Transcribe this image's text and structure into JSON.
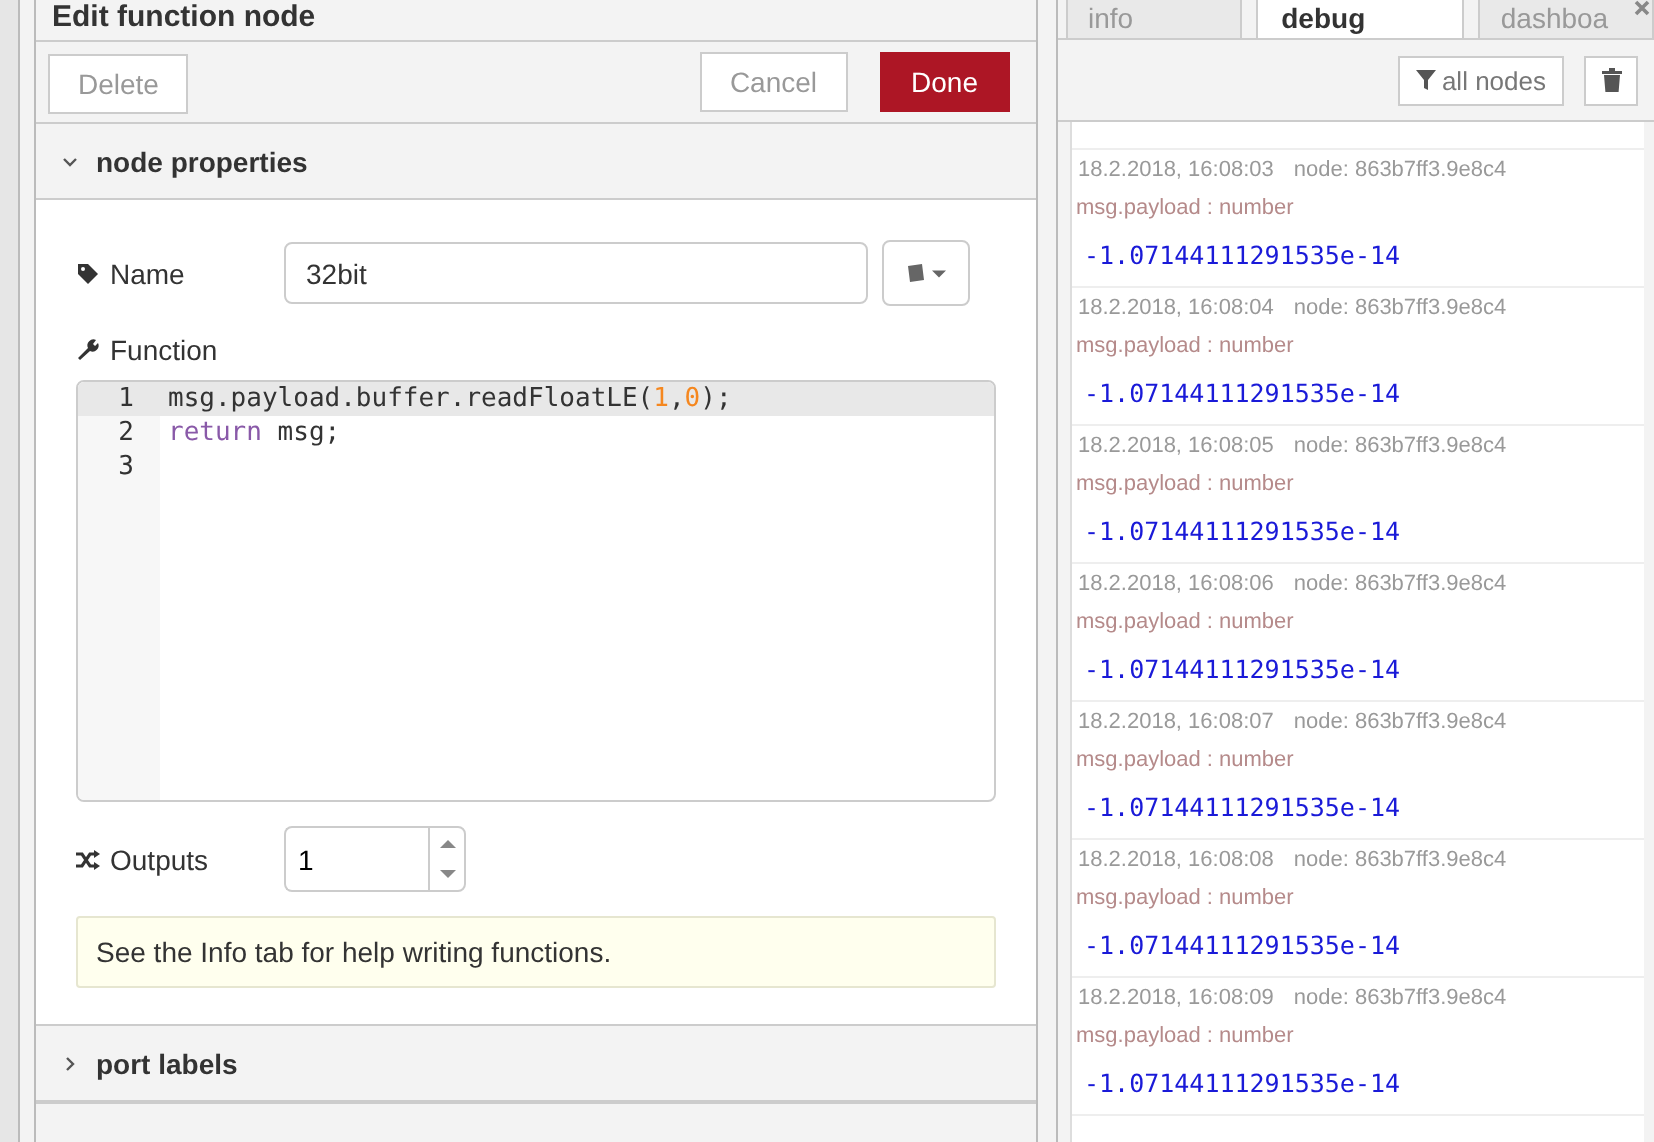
{
  "tray": {
    "title": "Edit function node",
    "buttons": [
      {
        "label": "Delete",
        "kind": "plain"
      },
      {
        "label": "Cancel",
        "kind": "plain"
      },
      {
        "label": "Done",
        "kind": "primary"
      }
    ],
    "sections": [
      {
        "title": "node properties",
        "expanded": true
      },
      {
        "title": "port labels",
        "expanded": false
      }
    ],
    "name_field": {
      "label": "Name",
      "value": "32bit"
    },
    "function": {
      "label": "Function",
      "lines": [
        [
          {
            "t": "msg.payload.buffer.readFloatLE(",
            "color": "#333333"
          },
          {
            "t": "1",
            "color": "#f5871f"
          },
          {
            "t": ",",
            "color": "#333333"
          },
          {
            "t": "0",
            "color": "#f5871f"
          },
          {
            "t": ");",
            "color": "#333333"
          }
        ],
        [
          {
            "t": "return",
            "color": "#8959a8"
          },
          {
            "t": " msg;",
            "color": "#333333"
          }
        ]
      ],
      "line_numbers": [
        "1",
        "2",
        "3"
      ]
    },
    "outputs": {
      "label": "Outputs",
      "value": "1"
    },
    "tip": "See the Info tab for help writing functions."
  },
  "sidebar": {
    "tabs": [
      {
        "label": "info",
        "selected": false
      },
      {
        "label": "debug",
        "selected": true
      },
      {
        "label": "dashboa",
        "selected": false
      }
    ],
    "filter_button": "all nodes",
    "messages": [
      {
        "time": "18.2.2018, 16:08:03",
        "node": "node: 863b7ff3.9e8c4",
        "meta": "msg.payload : number",
        "value": "-1.07144111291535e-14"
      },
      {
        "time": "18.2.2018, 16:08:04",
        "node": "node: 863b7ff3.9e8c4",
        "meta": "msg.payload : number",
        "value": "-1.07144111291535e-14"
      },
      {
        "time": "18.2.2018, 16:08:05",
        "node": "node: 863b7ff3.9e8c4",
        "meta": "msg.payload : number",
        "value": "-1.07144111291535e-14"
      },
      {
        "time": "18.2.2018, 16:08:06",
        "node": "node: 863b7ff3.9e8c4",
        "meta": "msg.payload : number",
        "value": "-1.07144111291535e-14"
      },
      {
        "time": "18.2.2018, 16:08:07",
        "node": "node: 863b7ff3.9e8c4",
        "meta": "msg.payload : number",
        "value": "-1.07144111291535e-14"
      },
      {
        "time": "18.2.2018, 16:08:08",
        "node": "node: 863b7ff3.9e8c4",
        "meta": "msg.payload : number",
        "value": "-1.07144111291535e-14"
      },
      {
        "time": "18.2.2018, 16:08:09",
        "node": "node: 863b7ff3.9e8c4",
        "meta": "msg.payload : number",
        "value": "-1.07144111291535e-14"
      }
    ]
  }
}
